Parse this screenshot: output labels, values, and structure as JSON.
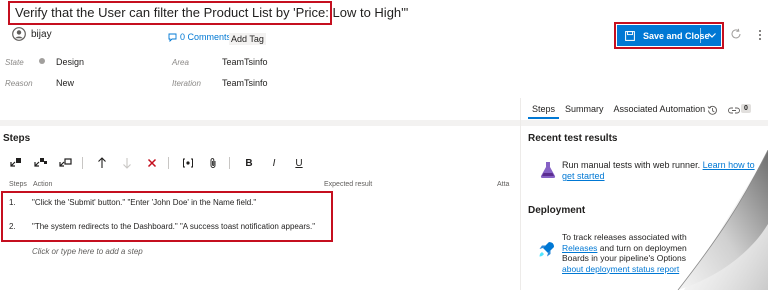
{
  "work_item": {
    "title": "Verify that the User can filter the Product List by 'Price: Low to High'\"",
    "owner": "bijay",
    "comments_label": "0 Comments",
    "add_tag_label": "Add Tag"
  },
  "toolbar": {
    "save_label": "Save and Close"
  },
  "fields": {
    "state_label": "State",
    "state_value": "Design",
    "reason_label": "Reason",
    "reason_value": "New",
    "area_label": "Area",
    "area_value": "TeamTsinfo",
    "iteration_label": "Iteration",
    "iteration_value": "TeamTsinfo"
  },
  "right_tabs": {
    "tabs": [
      "Steps",
      "Summary",
      "Associated Automation"
    ],
    "links_count": "0"
  },
  "steps": {
    "heading": "Steps",
    "columns": {
      "steps": "Steps",
      "action": "Action",
      "expected": "Expected result",
      "attachments": "Atta"
    },
    "rows": [
      {
        "num": "1.",
        "action": "\"Click the 'Submit' button.\" \"Enter 'John Doe' in the Name field.\""
      },
      {
        "num": "2.",
        "action": "\"The system redirects to the Dashboard.\" \"A success toast notification appears.\""
      }
    ],
    "add_step_placeholder": "Click or type here to add a step",
    "toolbar_items": {
      "bold": "B",
      "italic": "I",
      "underline": "U"
    }
  },
  "recent_results": {
    "heading": "Recent test results",
    "text_before_link": "Run manual tests with web runner. ",
    "link_text": "Learn how to get started"
  },
  "deployment": {
    "heading": "Deployment",
    "line1": "To track releases associated with",
    "line2_link": "Releases",
    "line2_rest": " and turn on deploymen",
    "line3": "Boards in your pipeline's Options",
    "line4_link": "about deployment status report"
  },
  "colors": {
    "accent": "#0078d4",
    "highlight_border": "#c50f1f"
  }
}
